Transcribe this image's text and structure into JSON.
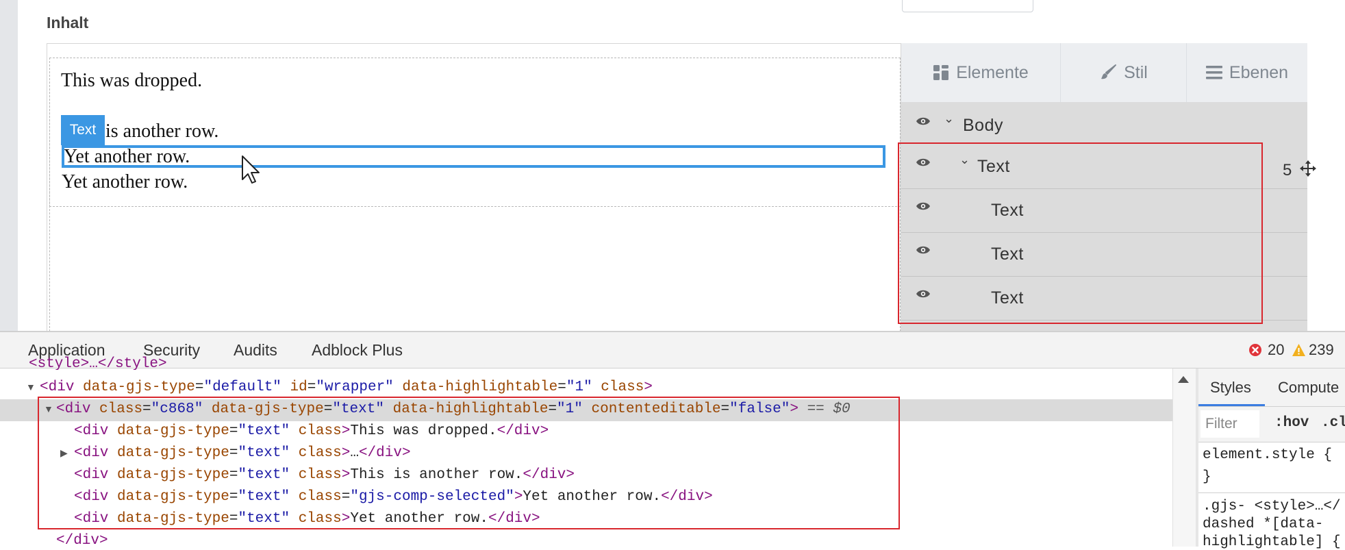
{
  "editor": {
    "section_title": "Inhalt",
    "canvas_rows": [
      "This was dropped.",
      "is another row.",
      "Yet another row.",
      "Yet another row."
    ],
    "selected_badge": "Text"
  },
  "panel": {
    "tabs": [
      {
        "label": "Elemente",
        "icon": "grid-icon"
      },
      {
        "label": "Stil",
        "icon": "brush-icon"
      },
      {
        "label": "Ebenen",
        "icon": "bars-icon"
      }
    ],
    "layers": {
      "body": "Body",
      "text_parent": "Text",
      "children": [
        "Text",
        "Text",
        "Text"
      ],
      "child_count": "5"
    }
  },
  "devtools": {
    "tabs": [
      "Application",
      "Security",
      "Audits",
      "Adblock Plus"
    ],
    "error_count": "20",
    "warning_count": "239",
    "dom": {
      "style_line": "<style>…</style>",
      "wrapper": {
        "tag": "div",
        "attrs": [
          [
            "data-gjs-type",
            "default"
          ],
          [
            "id",
            "wrapper"
          ],
          [
            "data-highlightable",
            "1"
          ]
        ],
        "bare_attr": "class"
      },
      "selected": {
        "tag": "div",
        "attrs": [
          [
            "class",
            "c868"
          ],
          [
            "data-gjs-type",
            "text"
          ],
          [
            "data-highlightable",
            "1"
          ],
          [
            "contenteditable",
            "false"
          ]
        ],
        "suffix": "== $0"
      },
      "children": [
        {
          "type_attr": "data-gjs-type",
          "type_val": "text",
          "class_attr": "class",
          "class_val": "",
          "content": "This was dropped."
        },
        {
          "type_attr": "data-gjs-type",
          "type_val": "text",
          "class_attr": "class",
          "class_val": "",
          "content": "…"
        },
        {
          "type_attr": "data-gjs-type",
          "type_val": "text",
          "class_attr": "class",
          "class_val": "",
          "content": "This is another row."
        },
        {
          "type_attr": "data-gjs-type",
          "type_val": "text",
          "class_attr": "class",
          "class_val": "gjs-comp-selected",
          "content": "Yet another row."
        },
        {
          "type_attr": "data-gjs-type",
          "type_val": "text",
          "class_attr": "class",
          "class_val": "",
          "content": "Yet another row."
        }
      ],
      "closing": "</div>"
    },
    "styles_pane": {
      "tabs": [
        "Styles",
        "Compute"
      ],
      "filter_placeholder": "Filter",
      "hov": ":hov",
      "cls": ".cl",
      "element_style": "element.style {",
      "close_brace": "}",
      "rule_lines": [
        ".gjs-  <style>…</",
        "dashed *[data-",
        "highlightable] {"
      ]
    }
  },
  "colors": {
    "selection_blue": "#3b97e3",
    "annotation_red": "#d8262d",
    "tag": "#881280",
    "attr_name": "#994500",
    "attr_value": "#1a1aa6"
  }
}
